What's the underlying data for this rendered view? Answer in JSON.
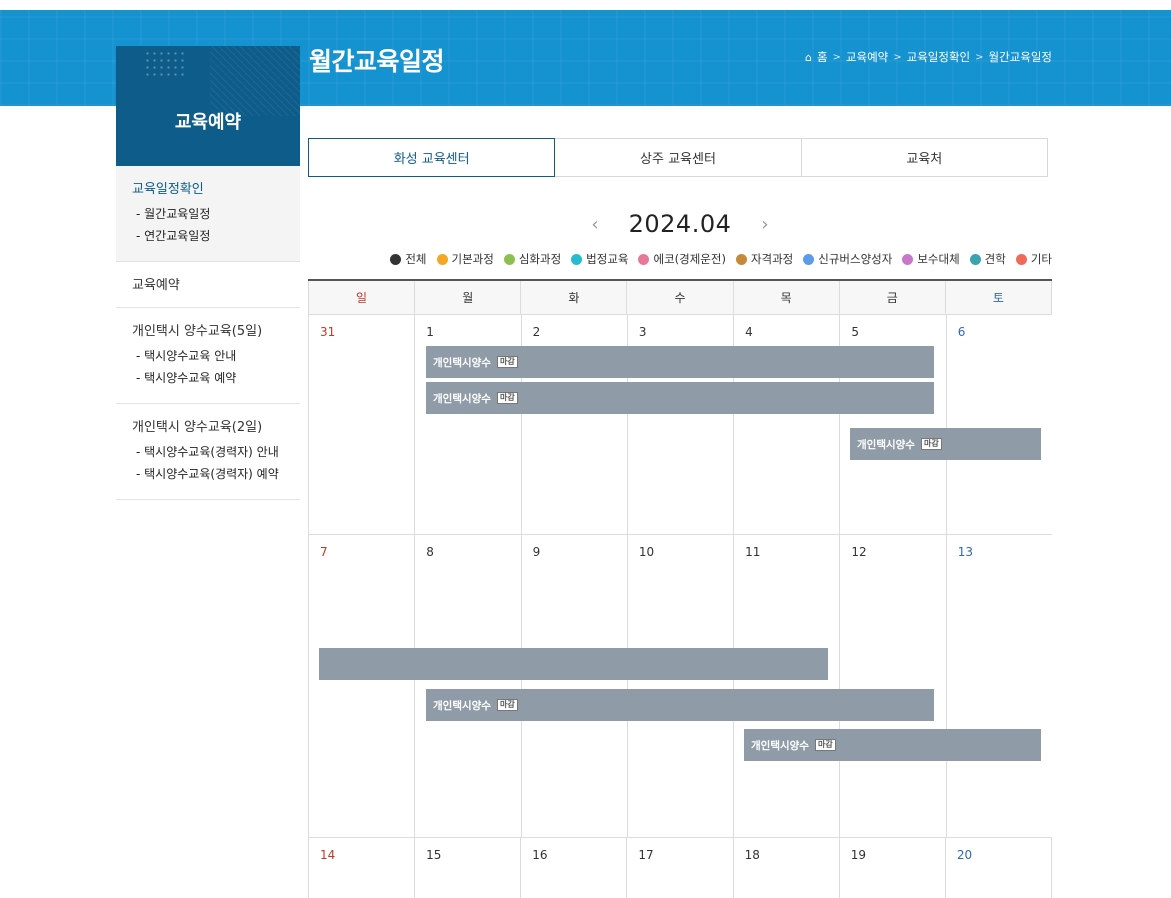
{
  "page": {
    "title": "월간교육일정",
    "breadcrumb": [
      "홈",
      "교육예약",
      "교육일정확인",
      "월간교육일정"
    ]
  },
  "sidebar": {
    "title": "교육예약",
    "groups": [
      {
        "title": "교육일정확인",
        "items": [
          "- 월간교육일정",
          "- 연간교육일정"
        ]
      },
      {
        "title": "교육예약",
        "items": []
      },
      {
        "title": "개인택시 양수교육(5일)",
        "items": [
          "- 택시양수교육 안내",
          "- 택시양수교육 예약"
        ]
      },
      {
        "title": "개인택시 양수교육(2일)",
        "items": [
          "- 택시양수교육(경력자) 안내",
          "- 택시양수교육(경력자) 예약"
        ]
      }
    ]
  },
  "tabs": [
    "화성 교육센터",
    "상주 교육센터",
    "교육처"
  ],
  "calendar": {
    "month": "2024.04",
    "prev_arrow": "‹",
    "next_arrow": "›",
    "weekdays": [
      "일",
      "월",
      "화",
      "수",
      "목",
      "금",
      "토"
    ],
    "weeks": [
      [
        "31",
        "1",
        "2",
        "3",
        "4",
        "5",
        "6"
      ],
      [
        "7",
        "8",
        "9",
        "10",
        "11",
        "12",
        "13"
      ],
      [
        "14",
        "15",
        "16",
        "17",
        "18",
        "19",
        "20"
      ]
    ],
    "event_name": "개인택시양수",
    "closed_badge": "마감"
  },
  "legend": [
    {
      "label": "전체",
      "color": "#333333"
    },
    {
      "label": "기본과정",
      "color": "#f5a623"
    },
    {
      "label": "심화과정",
      "color": "#8cc152"
    },
    {
      "label": "법정교육",
      "color": "#26bcd0"
    },
    {
      "label": "에코(경제운전)",
      "color": "#e8789a"
    },
    {
      "label": "자격과정",
      "color": "#c48a3a"
    },
    {
      "label": "신규버스양성자",
      "color": "#5b9bea"
    },
    {
      "label": "보수대체",
      "color": "#c978c9"
    },
    {
      "label": "견학",
      "color": "#3aa3b0"
    },
    {
      "label": "기타",
      "color": "#ee6b5a"
    }
  ]
}
